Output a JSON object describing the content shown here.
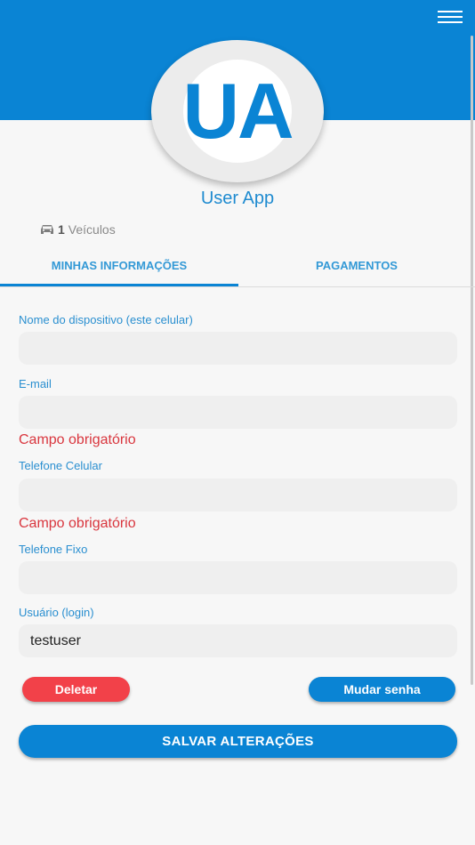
{
  "header": {
    "initials": "UA",
    "user_name": "User App"
  },
  "vehicles": {
    "count": "1",
    "label": "Veículos"
  },
  "tabs": [
    {
      "label": "MINHAS INFORMAÇÕES",
      "active": true
    },
    {
      "label": "PAGAMENTOS",
      "active": false
    }
  ],
  "form": {
    "device_name": {
      "label": "Nome do dispositivo (este celular)",
      "value": ""
    },
    "email": {
      "label": "E-mail",
      "value": "",
      "error": "Campo obrigatório"
    },
    "mobile": {
      "label": "Telefone Celular",
      "value": "",
      "error": "Campo obrigatório"
    },
    "landline": {
      "label": "Telefone Fixo",
      "value": ""
    },
    "username": {
      "label": "Usuário (login)",
      "value": "testuser"
    }
  },
  "actions": {
    "delete_label": "Deletar",
    "change_password_label": "Mudar senha",
    "save_label": "SALVAR ALTERAÇÕES"
  },
  "colors": {
    "primary": "#0a84d4",
    "danger": "#f24149",
    "error_text": "#d9363e"
  }
}
